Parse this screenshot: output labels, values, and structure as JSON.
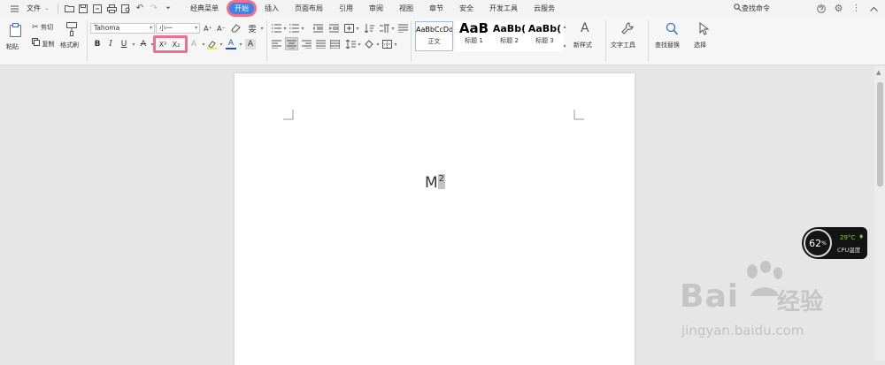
{
  "menubar": {
    "file_label": "文件",
    "tabs": [
      {
        "label": "经典菜单"
      },
      {
        "label": "开始"
      },
      {
        "label": "插入"
      },
      {
        "label": "页面布局"
      },
      {
        "label": "引用"
      },
      {
        "label": "审阅"
      },
      {
        "label": "视图"
      },
      {
        "label": "章节"
      },
      {
        "label": "安全"
      },
      {
        "label": "开发工具"
      },
      {
        "label": "云服务"
      }
    ],
    "active_tab": "开始",
    "find_command": "查找命令"
  },
  "ribbon": {
    "paste": "粘贴",
    "cut": "剪切",
    "copy": "复制",
    "format_painter": "格式刷",
    "font_name": "Tahoma",
    "font_size": "小一",
    "styles": [
      {
        "sample": "AaBbCcDd",
        "name": "正文"
      },
      {
        "sample": "AaB",
        "name": "标题 1"
      },
      {
        "sample": "AaBb(",
        "name": "标题 2"
      },
      {
        "sample": "AaBb(",
        "name": "标题 3"
      }
    ],
    "new_style": "新样式",
    "text_tools": "文字工具",
    "find_replace": "查找替换",
    "select": "选择"
  },
  "document": {
    "base_text": "M",
    "superscript_text": "2"
  },
  "cpu_widget": {
    "percent": "62",
    "percent_unit": "%",
    "temperature": "29°C",
    "label": "CPU温度"
  },
  "watermark": {
    "brand": "Bai",
    "brand_cn": "经验",
    "url": "jingyan.baidu.com"
  },
  "colors": {
    "accent": "#3a86e8",
    "highlight": "#ef6e93"
  }
}
